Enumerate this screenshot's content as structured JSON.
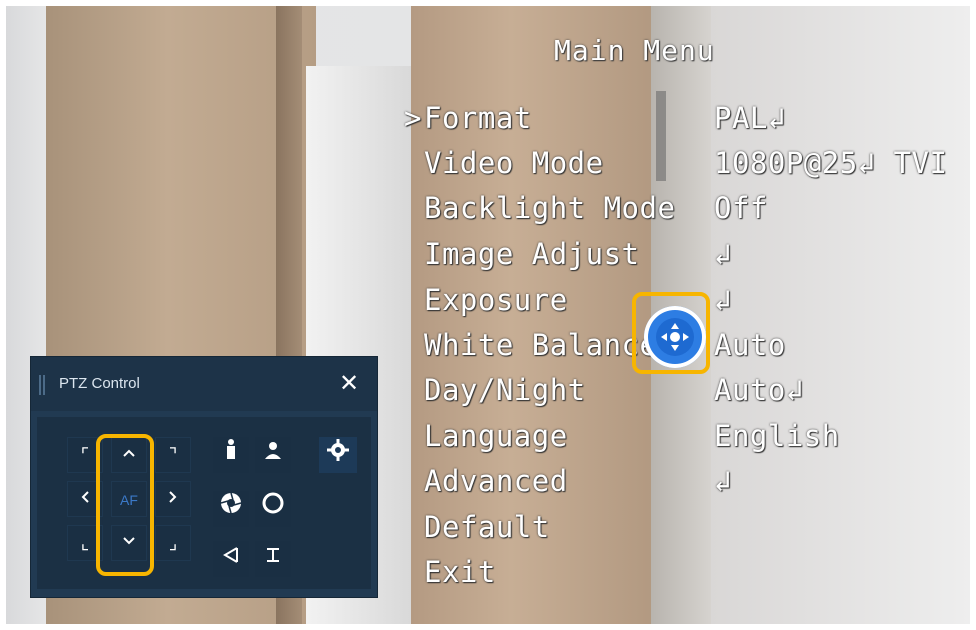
{
  "osd": {
    "title": "Main Menu",
    "cursor": ">",
    "items": [
      {
        "label": "Format",
        "value": "PAL↲"
      },
      {
        "label": "Video Mode",
        "value": "1080P@25↲ TVI"
      },
      {
        "label": "Backlight Mode",
        "value": "Off"
      },
      {
        "label": "Image Adjust",
        "value": "↲"
      },
      {
        "label": "Exposure",
        "value": "↲"
      },
      {
        "label": "White Balance",
        "value": "Auto"
      },
      {
        "label": "Day/Night",
        "value": "Auto↲"
      },
      {
        "label": "Language",
        "value": "English"
      },
      {
        "label": "Advanced",
        "value": "↲"
      },
      {
        "label": "Default",
        "value": ""
      },
      {
        "label": "Exit",
        "value": ""
      }
    ]
  },
  "ptz": {
    "title": "PTZ Control",
    "close": "✕",
    "af_label": "AF",
    "icons": {
      "up": "chevron-up-icon",
      "down": "chevron-down-icon",
      "left": "chevron-left-icon",
      "right": "chevron-right-icon",
      "settings": "gear-icon"
    },
    "accent_color": "#f7b500",
    "panel_color": "#213a52"
  }
}
